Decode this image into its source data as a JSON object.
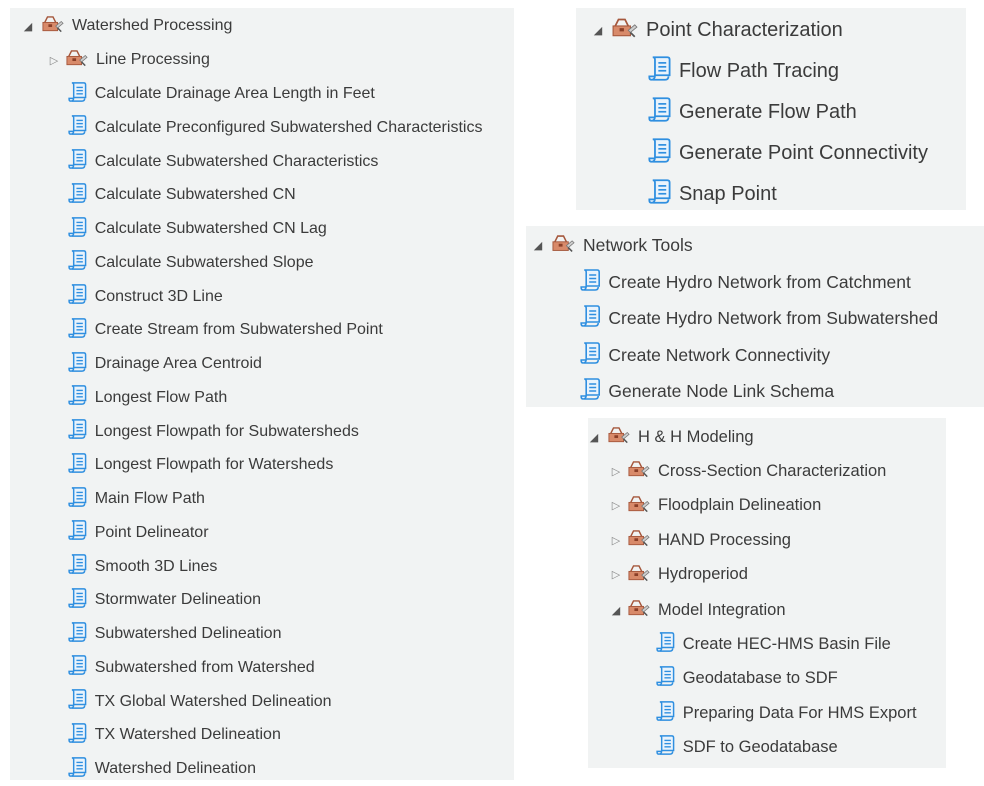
{
  "colors": {
    "panel_bg": "#f1f3f3",
    "text": "#3b3b3b",
    "toolbox_brown": "#c06a4a",
    "script_blue": "#2f8fe0"
  },
  "watershed_panel": {
    "header": "Watershed Processing",
    "subgroup": "Line Processing",
    "tools": [
      "Calculate Drainage Area Length in Feet",
      "Calculate Preconfigured Subwatershed Characteristics",
      "Calculate Subwatershed Characteristics",
      "Calculate Subwatershed CN",
      "Calculate Subwatershed CN Lag",
      "Calculate Subwatershed Slope",
      "Construct 3D Line",
      "Create Stream from Subwatershed Point",
      "Drainage Area Centroid",
      "Longest Flow Path",
      "Longest Flowpath for Subwatersheds",
      "Longest Flowpath for Watersheds",
      "Main Flow Path",
      "Point Delineator",
      "Smooth 3D Lines",
      "Stormwater Delineation",
      "Subwatershed Delineation",
      "Subwatershed from Watershed",
      "TX Global Watershed Delineation",
      "TX Watershed Delineation",
      "Watershed Delineation"
    ]
  },
  "point_panel": {
    "header": "Point Characterization",
    "tools": [
      "Flow Path Tracing",
      "Generate Flow Path",
      "Generate Point Connectivity",
      "Snap Point"
    ]
  },
  "network_panel": {
    "header": "Network Tools",
    "tools": [
      "Create Hydro Network from Catchment",
      "Create Hydro Network from Subwatershed",
      "Create Network Connectivity",
      "Generate Node Link Schema"
    ]
  },
  "hh_panel": {
    "header": "H & H Modeling",
    "groups": [
      "Cross-Section Characterization",
      "Floodplain Delineation",
      "HAND Processing",
      "Hydroperiod"
    ],
    "expanded_group": "Model Integration",
    "tools": [
      "Create HEC-HMS Basin File",
      "Geodatabase to SDF",
      "Preparing Data For HMS Export",
      "SDF to Geodatabase"
    ]
  }
}
